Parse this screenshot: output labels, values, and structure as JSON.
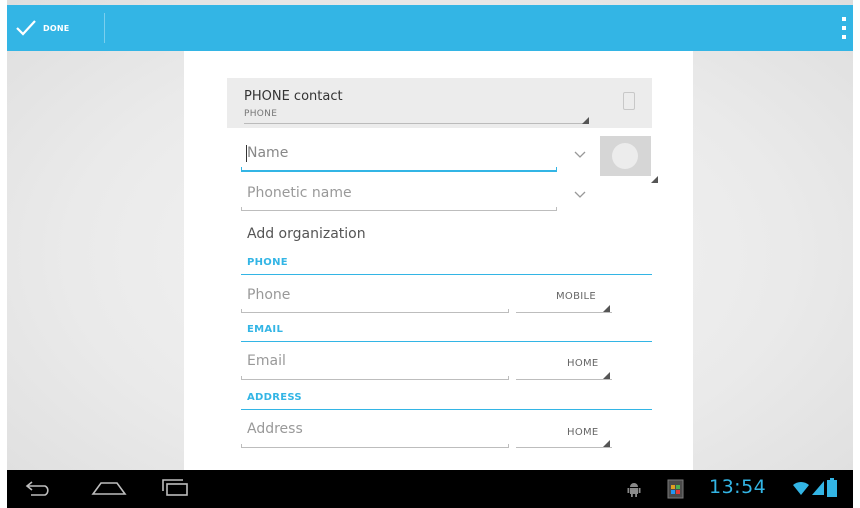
{
  "action_bar": {
    "done_label": "DONE",
    "accent_color": "#33b5e5"
  },
  "account": {
    "title": "PHONE contact",
    "subtitle": "PHONE"
  },
  "fields": {
    "name": {
      "placeholder": "Name"
    },
    "phonetic_name": {
      "placeholder": "Phonetic name"
    },
    "add_organization": "Add organization"
  },
  "sections": [
    {
      "header": "PHONE",
      "placeholder": "Phone",
      "type": "MOBILE"
    },
    {
      "header": "EMAIL",
      "placeholder": "Email",
      "type": "HOME"
    },
    {
      "header": "ADDRESS",
      "placeholder": "Address",
      "type": "HOME"
    }
  ],
  "system_bar": {
    "clock": "13:54",
    "icons": [
      "back-icon",
      "home-icon",
      "recent-apps-icon",
      "android-icon",
      "gallery-notification-icon",
      "wifi-icon",
      "signal-icon",
      "battery-icon"
    ]
  }
}
